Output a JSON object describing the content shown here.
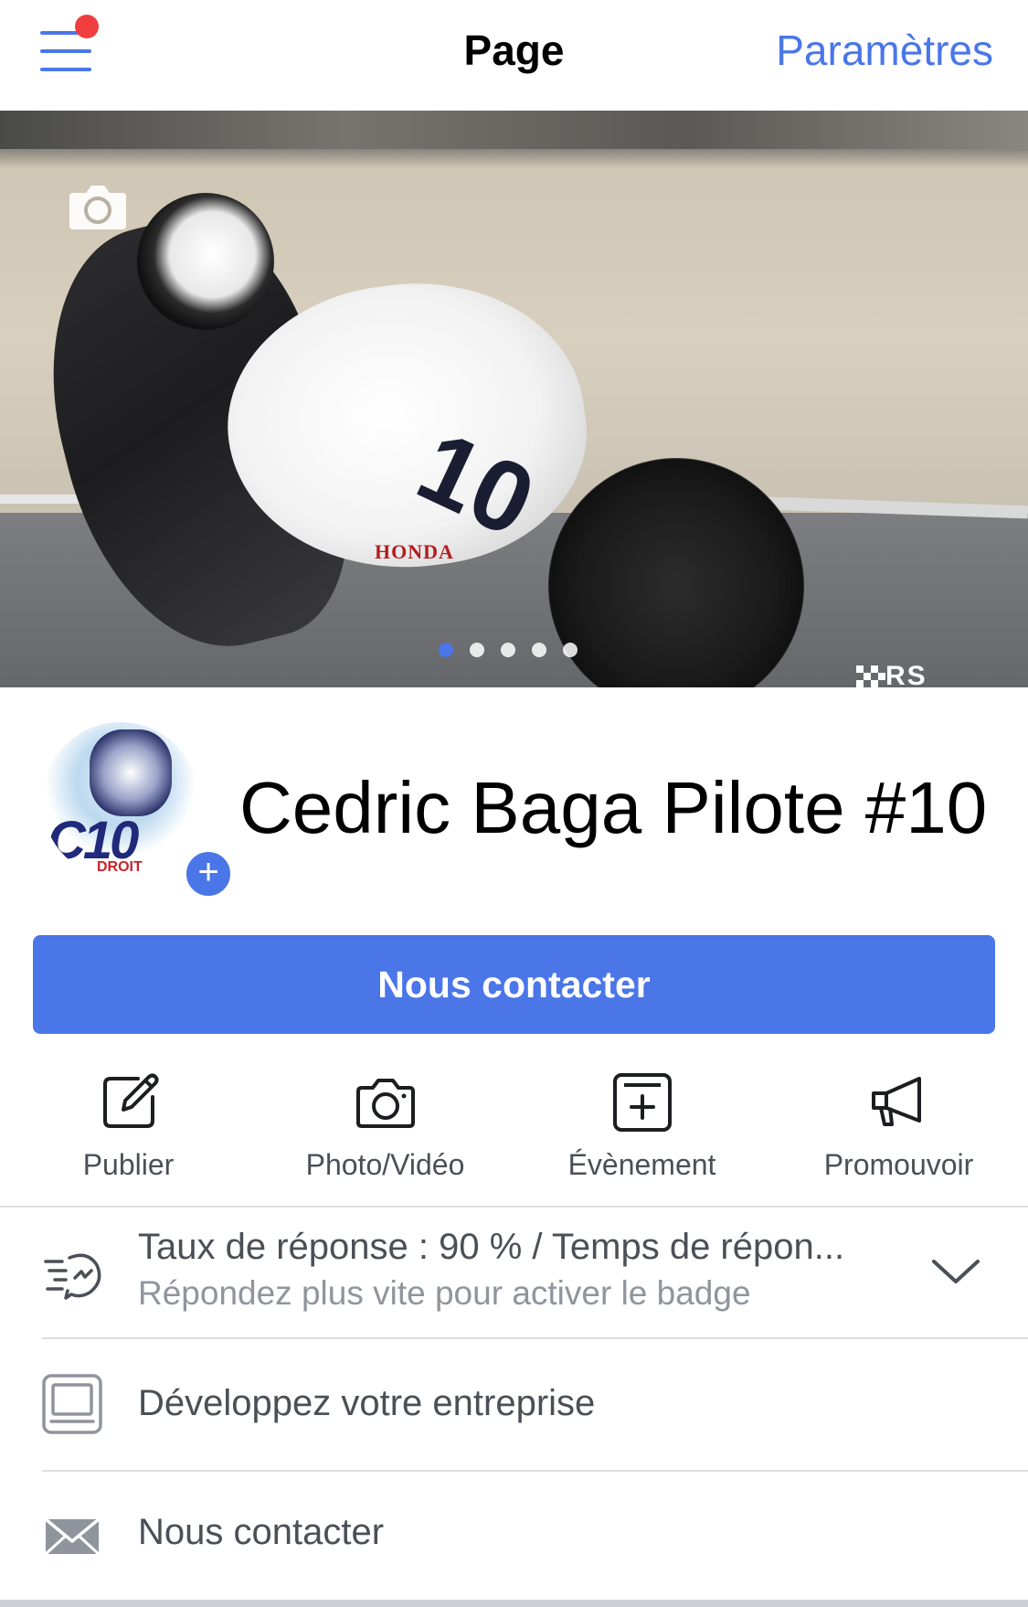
{
  "navbar": {
    "title": "Page",
    "settings_label": "Paramètres",
    "menu_icon": "hamburger-menu-icon",
    "has_notification": true
  },
  "cover": {
    "camera_icon": "camera-icon",
    "pager_count": 5,
    "pager_active_index": 0,
    "bike_number": "10",
    "bike_brand": "HONDA",
    "watermark": "RS"
  },
  "profile": {
    "page_name": "Cedric Baga Pilote #10",
    "logo_text": "C10",
    "logo_sub": "DROIT",
    "add_photo_icon": "plus-icon"
  },
  "contact_button": {
    "label": "Nous contacter"
  },
  "actions": [
    {
      "label": "Publier",
      "icon": "edit-icon"
    },
    {
      "label": "Photo/Vidéo",
      "icon": "camera-icon"
    },
    {
      "label": "Évènement",
      "icon": "calendar-add-icon"
    },
    {
      "label": "Promouvoir",
      "icon": "megaphone-icon"
    }
  ],
  "rows": {
    "response": {
      "title": "Taux de réponse : 90 % / Temps de répon...",
      "subtitle": "Répondez plus vite pour activer le badge",
      "icon": "response-speed-icon",
      "chevron_icon": "chevron-down-icon"
    },
    "business": {
      "title": "Développez votre entreprise",
      "icon": "monitor-icon"
    },
    "contact": {
      "title": "Nous contacter",
      "icon": "envelope-icon"
    }
  },
  "colors": {
    "accent": "#4a76e8",
    "notification": "#f03e3e",
    "text_secondary": "#4b4f56",
    "text_muted": "#90949c"
  }
}
